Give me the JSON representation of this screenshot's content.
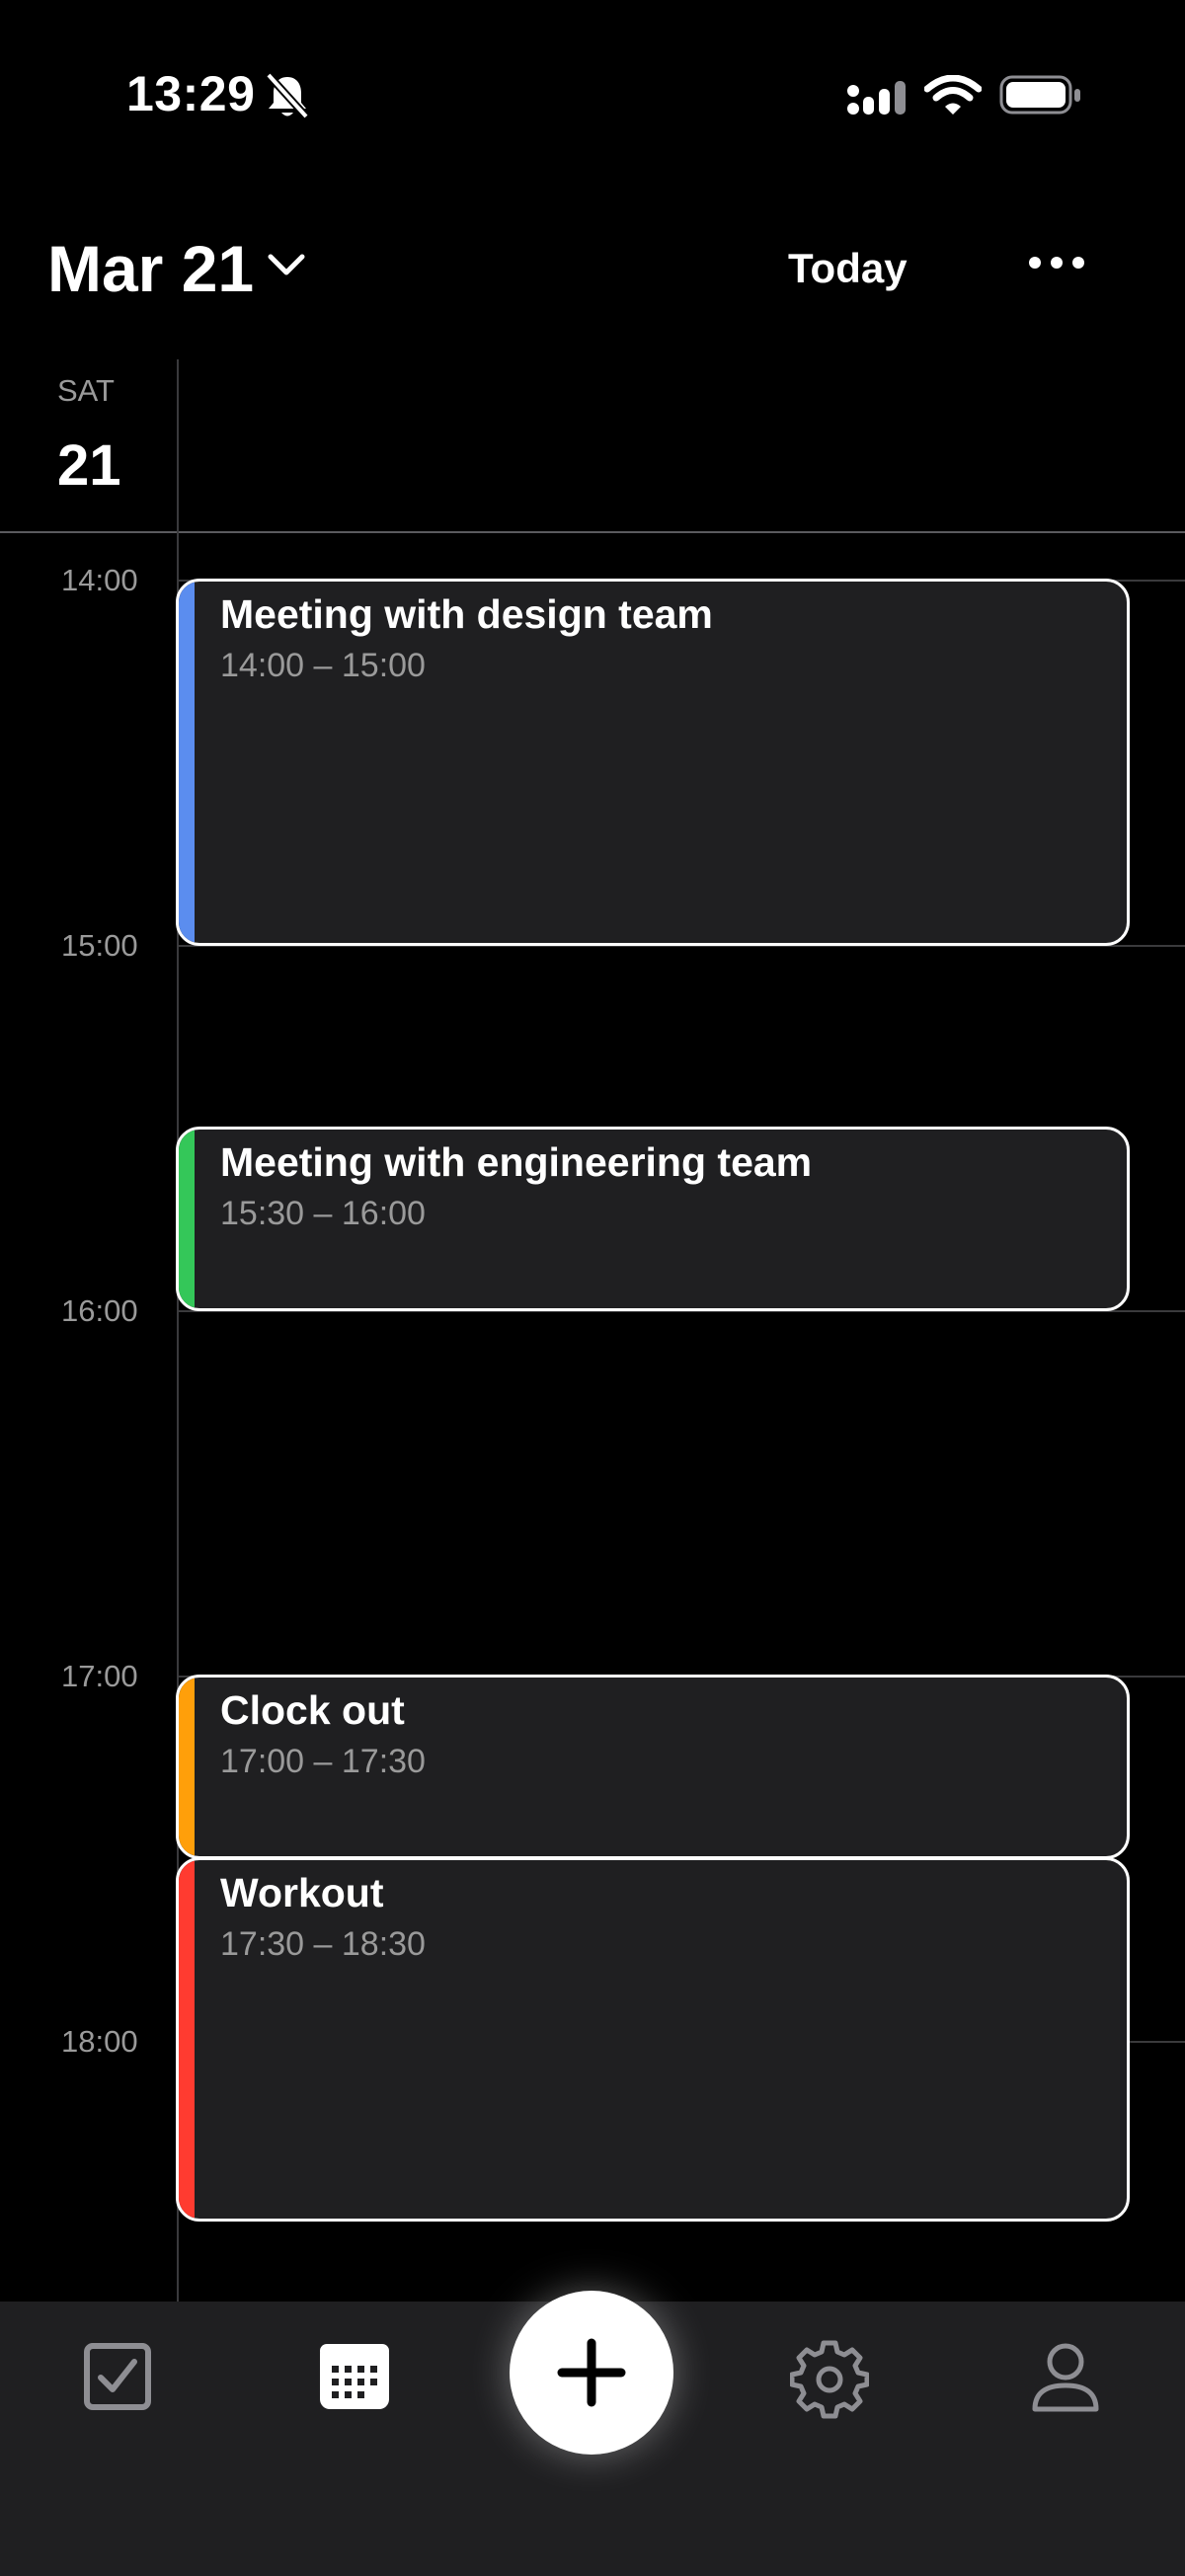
{
  "status_bar": {
    "time": "13:29",
    "icons": [
      "bell-slash-icon",
      "cellular-signal-icon",
      "wifi-icon",
      "battery-icon"
    ]
  },
  "header": {
    "title": "Mar 21",
    "today_label": "Today",
    "dropdown_icon": "chevron-down-icon",
    "more_icon": "ellipsis-icon"
  },
  "day": {
    "weekday": "SAT",
    "number": "21"
  },
  "hours": [
    "14:00",
    "15:00",
    "16:00",
    "17:00",
    "18:00"
  ],
  "events": [
    {
      "title": "Meeting with design team",
      "time": "14:00 – 15:00",
      "color": "#5b8def"
    },
    {
      "title": "Meeting with engineering team",
      "time": "15:30 – 16:00",
      "color": "#34c759"
    },
    {
      "title": "Clock out",
      "time": "17:00 – 17:30",
      "color": "#ff9f0a"
    },
    {
      "title": "Workout",
      "time": "17:30 – 18:30",
      "color": "#ff3b30"
    }
  ],
  "tab_bar": {
    "tabs": [
      "checkbox-icon",
      "calendar-icon",
      "plus-icon",
      "gear-icon",
      "person-icon"
    ]
  }
}
